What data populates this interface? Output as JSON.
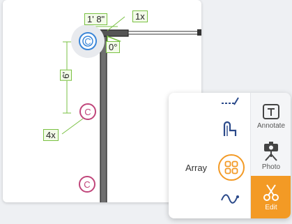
{
  "canvas": {
    "dimensions": {
      "top_length": "1' 8\"",
      "angle": "0°",
      "vertical_length": "6'",
      "top_count": "1x",
      "array_count": "4x"
    },
    "fixtures": [
      {
        "symbol": "C",
        "state": "selected"
      },
      {
        "symbol": "C",
        "state": "normal"
      },
      {
        "symbol": "C",
        "state": "normal"
      }
    ]
  },
  "tool_panel": {
    "array_label": "Array",
    "annotate_label": "Annotate",
    "photo_label": "Photo",
    "edit_label": "Edit",
    "icons": {
      "line": "dashed-line-icon",
      "pipe": "pipe-fitting-icon",
      "array": "grid-array-icon",
      "wave": "wave-line-icon",
      "annotate": "text-box-icon",
      "photo": "camera-tripod-icon",
      "edit": "scissors-icon"
    },
    "colors": {
      "accent": "#f39a25",
      "fixture": "#c0457a",
      "selected": "#3a86d8",
      "dimension": "#7ac143"
    }
  }
}
